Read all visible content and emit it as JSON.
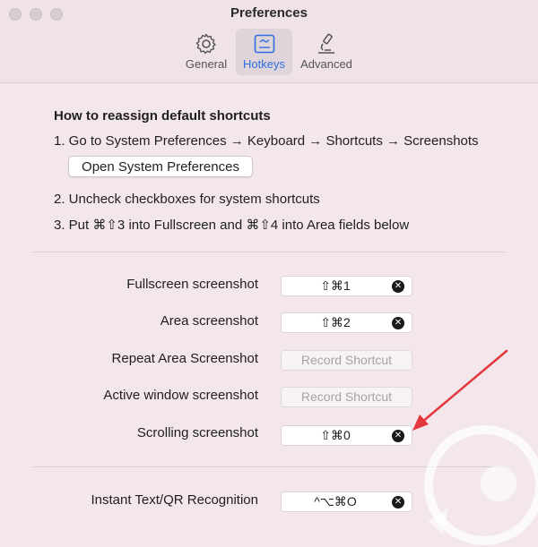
{
  "window": {
    "title": "Preferences"
  },
  "tabs": [
    {
      "label": "General",
      "icon": "gear-icon"
    },
    {
      "label": "Hotkeys",
      "icon": "keyboard-icon",
      "selected": true
    },
    {
      "label": "Advanced",
      "icon": "microscope-icon"
    }
  ],
  "instructions": {
    "heading": "How to reassign default shortcuts",
    "step1": "1. Go to System Preferences → Keyboard → Shortcuts → Screenshots",
    "open_button": "Open System Preferences",
    "step2": "2. Uncheck checkboxes for system shortcuts",
    "step3": "3. Put ⌘⇧3 into Fullscreen and ⌘⇧4 into Area fields below"
  },
  "shortcuts": [
    {
      "label": "Fullscreen screenshot",
      "value": "⇧⌘1",
      "has_clear": true
    },
    {
      "label": "Area screenshot",
      "value": "⇧⌘2",
      "has_clear": true
    },
    {
      "label": "Repeat Area Screenshot",
      "value": "Record Shortcut",
      "has_clear": false
    },
    {
      "label": "Active window screenshot",
      "value": "Record Shortcut",
      "has_clear": false
    },
    {
      "label": "Scrolling screenshot",
      "value": "⇧⌘0",
      "has_clear": true
    },
    {
      "label": "Instant Text/QR Recognition",
      "value": "^⌥⌘O",
      "has_clear": true
    }
  ],
  "colors": {
    "accent": "#2f6fe0",
    "annotation_arrow": "#e4373d",
    "background": "#f3e7ec"
  }
}
